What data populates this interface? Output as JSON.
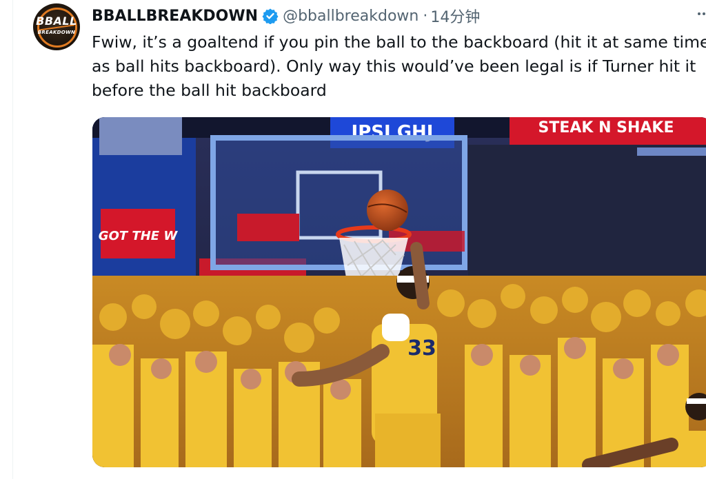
{
  "author": {
    "display_name": "BBALLBREAKDOWN",
    "handle": "@bballbreakdown",
    "separator": "·",
    "time": "14分钟",
    "avatar_logo_top": "BBALL",
    "avatar_logo_bottom": "BREAKDOWN",
    "verified_color": "#1d9bf0"
  },
  "tweet": {
    "text": "Fwiw, it’s a goaltend if you pin the ball to the backboard (hit it at same time\nas ball hits backboard). Only way this would’ve been legal is if Turner hit it\nbefore the ball hit backboard"
  },
  "media": {
    "signs": {
      "top_center": "IPSI GHJ",
      "top_right": "STEAK N SHAKE",
      "left_red": "GOT THE W"
    },
    "jersey_number": "33",
    "colors": {
      "crowd_gold": "#e3ac2c",
      "jersey_gold": "#f1c233",
      "sign_red": "#d4172a",
      "arena_blue": "#1b3d9e"
    }
  },
  "icons": {
    "more": "more-icon",
    "verified": "verified-badge-icon"
  }
}
